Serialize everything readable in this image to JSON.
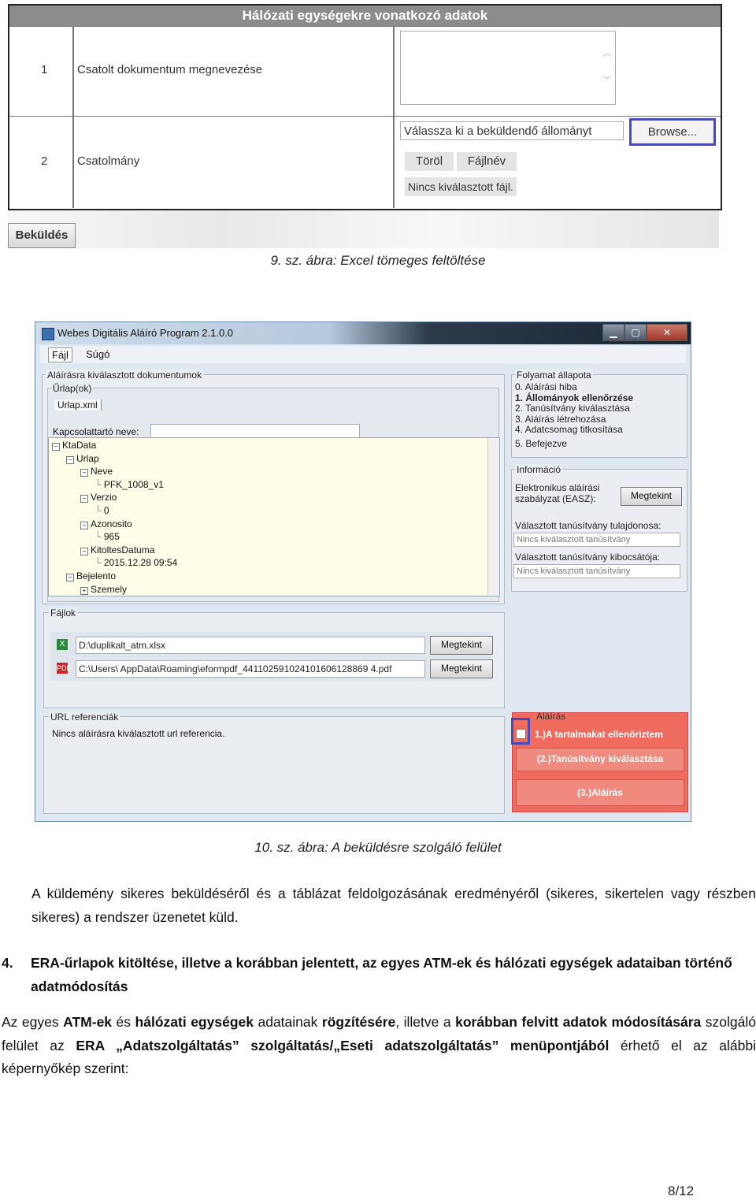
{
  "fig9": {
    "header": "Hálózati egységekre vonatkozó adatok",
    "rows": [
      {
        "num": "1",
        "label": "Csatolt dokumentum megnevezése"
      },
      {
        "num": "2",
        "label": "Csatolmány"
      }
    ],
    "file_placeholder": "Válassza ki a beküldendő állományt",
    "browse_label": "Browse...",
    "delete_label": "Töröl",
    "filename_label": "Fájlnév",
    "no_file_label": "Nincs kiválasztott fájl.",
    "submit_label": "Beküldés",
    "caption": "9.   sz. ábra: Excel tömeges feltöltése"
  },
  "fig10": {
    "title": "Webes Digitális Aláíró Program 2.1.0.0",
    "menu": [
      "Fájl",
      "Súgó"
    ],
    "group_docs": "Aláírásra kiválasztott dokumentumok",
    "group_forms": "Űrlap(ok)",
    "tab_form": "Urlap.xml",
    "contact_label": "Kapcsolattartó neve:",
    "tree": [
      {
        "text": "KtaData",
        "box": "−",
        "indent": 0
      },
      {
        "text": "Urlap",
        "box": "−",
        "indent": 1
      },
      {
        "text": "Neve",
        "box": "−",
        "indent": 2
      },
      {
        "text": "PFK_1008_v1",
        "box": "",
        "indent": 3
      },
      {
        "text": "Verzio",
        "box": "−",
        "indent": 2
      },
      {
        "text": "0",
        "box": "",
        "indent": 3
      },
      {
        "text": "Azonosito",
        "box": "−",
        "indent": 2
      },
      {
        "text": "965",
        "box": "",
        "indent": 3
      },
      {
        "text": "KitoltesDatuma",
        "box": "−",
        "indent": 2
      },
      {
        "text": "2015.12.28 09:54",
        "box": "",
        "indent": 3
      },
      {
        "text": "Bejelento",
        "box": "−",
        "indent": 1
      },
      {
        "text": "Szemely",
        "box": "+",
        "indent": 2
      }
    ],
    "group_files": "Fájlok",
    "files": [
      {
        "path": "D:\\duplikalt_atm.xlsx",
        "button": "Megtekint",
        "icon": "excel-icon"
      },
      {
        "path": "C:\\Users\\          AppData\\Roaming\\eformpdf_441102591024101606128869 4.pdf",
        "button": "Megtekint",
        "icon": "pdf-icon"
      }
    ],
    "group_url": "URL referenciák",
    "url_text": "Nincs aláírásra kiválasztott url referencia.",
    "group_status": "Folyamat állapota",
    "status_items": [
      {
        "text": "0. Aláírási hiba",
        "bold": false
      },
      {
        "text": "1. Állományok ellenőrzése",
        "bold": true
      },
      {
        "text": "2. Tanúsítvány kiválasztása",
        "bold": false
      },
      {
        "text": "3. Aláírás létrehozása",
        "bold": false
      },
      {
        "text": "4. Adatcsomag titkosítása",
        "bold": false
      },
      {
        "text": "5. Befejezve",
        "bold": false
      }
    ],
    "group_info": "Információ",
    "easz_label": "Elektronikus aláírási szabályzat (EASZ):",
    "easz_button": "Megtekint",
    "owner_label": "Választott tanúsítvány tulajdonosa:",
    "owner_value": "Nincs kiválasztott tanúsítvány",
    "issuer_label": "Választott tanúsítvány kibocsátója:",
    "issuer_value": "Nincs kiválasztott tanúsítvány",
    "group_sign": "Aláírás",
    "check_label": "1.)A tartalmakat ellenőriztem",
    "btn_cert": "(2.)Tanúsítvány kiválasztása",
    "btn_sign": "(3.)Aláírás",
    "caption": "10.  sz. ábra: A beküldésre szolgáló felület"
  },
  "text": {
    "para1": "A küldemény sikeres beküldéséről és a táblázat feldolgozásának eredményéről (sikeres, sikertelen vagy részben sikeres) a rendszer üzenetet küld.",
    "heading_num": "4.",
    "heading": "ERA-űrlapok kitöltése, illetve a korábban jelentett, az egyes ATM-ek és hálózati egységek adataiban történő adatmódosítás",
    "p2": [
      "Az egyes ",
      "ATM-ek",
      " és ",
      "hálózati egységek",
      " adatainak ",
      "rögzítésére",
      ", illetve a ",
      "korábban felvitt adatok módosítására",
      " szolgáló felület az ",
      "ERA „Adatszolgáltatás” szolgáltatás/„Eseti adatszolgáltatás” menüpontjából",
      " érhető el az alábbi képernyőkép szerint:"
    ],
    "page": "8/12"
  }
}
